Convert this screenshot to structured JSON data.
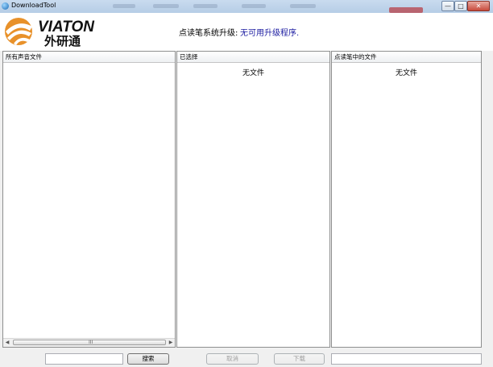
{
  "window": {
    "title": "DownloadTool"
  },
  "title_buttons": {
    "minimize": "—",
    "maximize": "□",
    "close": "✕"
  },
  "header": {
    "logo_text": "VIATON",
    "logo_cn": "外研通",
    "status_label": "点读笔系统升级:",
    "status_value": "无可用升级程序."
  },
  "panels": {
    "all_audio": {
      "header": "所有声音文件"
    },
    "selected": {
      "header": "已选择",
      "empty": "无文件"
    },
    "pen_files": {
      "header": "点读笔中的文件",
      "empty": "无文件"
    }
  },
  "scrollbar": {
    "left_arrow": "◀",
    "right_arrow": "▶",
    "grip": "III"
  },
  "footer": {
    "search_value": "",
    "search_button": "搜索",
    "cancel_button": "取消",
    "download_button": "下载",
    "path_value": ""
  }
}
